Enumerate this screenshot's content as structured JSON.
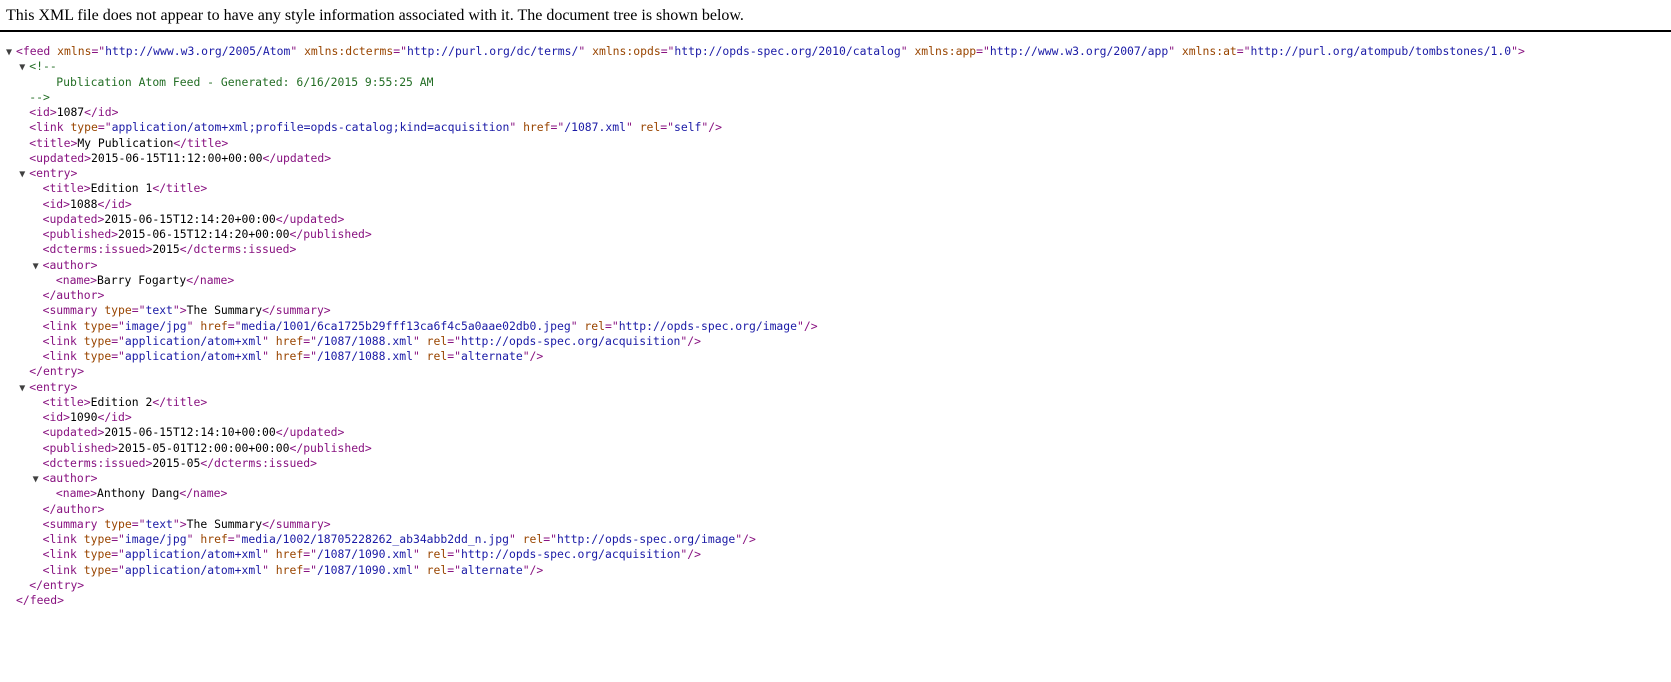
{
  "header": {
    "message": "This XML file does not appear to have any style information associated with it. The document tree is shown below."
  },
  "tree": [
    {
      "indent": 0,
      "toggle": true,
      "segs": [
        [
          "tag",
          "<feed"
        ],
        [
          "tx",
          " "
        ],
        [
          "an",
          "xmlns"
        ],
        [
          "tag",
          "=\""
        ],
        [
          "av",
          "http://www.w3.org/2005/Atom"
        ],
        [
          "tag",
          "\""
        ],
        [
          "tx",
          " "
        ],
        [
          "an",
          "xmlns:dcterms"
        ],
        [
          "tag",
          "=\""
        ],
        [
          "av",
          "http://purl.org/dc/terms/"
        ],
        [
          "tag",
          "\""
        ],
        [
          "tx",
          " "
        ],
        [
          "an",
          "xmlns:opds"
        ],
        [
          "tag",
          "=\""
        ],
        [
          "av",
          "http://opds-spec.org/2010/catalog"
        ],
        [
          "tag",
          "\""
        ],
        [
          "tx",
          " "
        ],
        [
          "an",
          "xmlns:app"
        ],
        [
          "tag",
          "=\""
        ],
        [
          "av",
          "http://www.w3.org/2007/app"
        ],
        [
          "tag",
          "\""
        ],
        [
          "tx",
          " "
        ],
        [
          "an",
          "xmlns:at"
        ],
        [
          "tag",
          "=\""
        ],
        [
          "av",
          "http://purl.org/atompub/tombstones/1.0"
        ],
        [
          "tag",
          "\">"
        ]
      ]
    },
    {
      "indent": 1,
      "toggle": true,
      "segs": [
        [
          "cm",
          "<!--"
        ]
      ]
    },
    {
      "indent": 2,
      "toggle": false,
      "segs": [
        [
          "cm",
          "  Publication Atom Feed - Generated: 6/16/2015 9:55:25 AM"
        ]
      ]
    },
    {
      "indent": 1,
      "toggle": false,
      "segs": [
        [
          "cm",
          "-->"
        ]
      ]
    },
    {
      "indent": 1,
      "toggle": false,
      "segs": [
        [
          "tag",
          "<id>"
        ],
        [
          "tx",
          "1087"
        ],
        [
          "tag",
          "</id>"
        ]
      ]
    },
    {
      "indent": 1,
      "toggle": false,
      "segs": [
        [
          "tag",
          "<link"
        ],
        [
          "tx",
          " "
        ],
        [
          "an",
          "type"
        ],
        [
          "tag",
          "=\""
        ],
        [
          "av",
          "application/atom+xml;profile=opds-catalog;kind=acquisition"
        ],
        [
          "tag",
          "\""
        ],
        [
          "tx",
          " "
        ],
        [
          "an",
          "href"
        ],
        [
          "tag",
          "=\""
        ],
        [
          "av",
          "/1087.xml"
        ],
        [
          "tag",
          "\""
        ],
        [
          "tx",
          " "
        ],
        [
          "an",
          "rel"
        ],
        [
          "tag",
          "=\""
        ],
        [
          "av",
          "self"
        ],
        [
          "tag",
          "\"/>"
        ]
      ]
    },
    {
      "indent": 1,
      "toggle": false,
      "segs": [
        [
          "tag",
          "<title>"
        ],
        [
          "tx",
          "My Publication"
        ],
        [
          "tag",
          "</title>"
        ]
      ]
    },
    {
      "indent": 1,
      "toggle": false,
      "segs": [
        [
          "tag",
          "<updated>"
        ],
        [
          "tx",
          "2015-06-15T11:12:00+00:00"
        ],
        [
          "tag",
          "</updated>"
        ]
      ]
    },
    {
      "indent": 1,
      "toggle": true,
      "segs": [
        [
          "tag",
          "<entry>"
        ]
      ]
    },
    {
      "indent": 2,
      "toggle": false,
      "segs": [
        [
          "tag",
          "<title>"
        ],
        [
          "tx",
          "Edition 1"
        ],
        [
          "tag",
          "</title>"
        ]
      ]
    },
    {
      "indent": 2,
      "toggle": false,
      "segs": [
        [
          "tag",
          "<id>"
        ],
        [
          "tx",
          "1088"
        ],
        [
          "tag",
          "</id>"
        ]
      ]
    },
    {
      "indent": 2,
      "toggle": false,
      "segs": [
        [
          "tag",
          "<updated>"
        ],
        [
          "tx",
          "2015-06-15T12:14:20+00:00"
        ],
        [
          "tag",
          "</updated>"
        ]
      ]
    },
    {
      "indent": 2,
      "toggle": false,
      "segs": [
        [
          "tag",
          "<published>"
        ],
        [
          "tx",
          "2015-06-15T12:14:20+00:00"
        ],
        [
          "tag",
          "</published>"
        ]
      ]
    },
    {
      "indent": 2,
      "toggle": false,
      "segs": [
        [
          "tag",
          "<dcterms:issued>"
        ],
        [
          "tx",
          "2015"
        ],
        [
          "tag",
          "</dcterms:issued>"
        ]
      ]
    },
    {
      "indent": 2,
      "toggle": true,
      "segs": [
        [
          "tag",
          "<author>"
        ]
      ]
    },
    {
      "indent": 3,
      "toggle": false,
      "segs": [
        [
          "tag",
          "<name>"
        ],
        [
          "tx",
          "Barry Fogarty"
        ],
        [
          "tag",
          "</name>"
        ]
      ]
    },
    {
      "indent": 2,
      "toggle": false,
      "segs": [
        [
          "tag",
          "</author>"
        ]
      ]
    },
    {
      "indent": 2,
      "toggle": false,
      "segs": [
        [
          "tag",
          "<summary"
        ],
        [
          "tx",
          " "
        ],
        [
          "an",
          "type"
        ],
        [
          "tag",
          "=\""
        ],
        [
          "av",
          "text"
        ],
        [
          "tag",
          "\">"
        ],
        [
          "tx",
          "The Summary"
        ],
        [
          "tag",
          "</summary>"
        ]
      ]
    },
    {
      "indent": 2,
      "toggle": false,
      "segs": [
        [
          "tag",
          "<link"
        ],
        [
          "tx",
          " "
        ],
        [
          "an",
          "type"
        ],
        [
          "tag",
          "=\""
        ],
        [
          "av",
          "image/jpg"
        ],
        [
          "tag",
          "\""
        ],
        [
          "tx",
          " "
        ],
        [
          "an",
          "href"
        ],
        [
          "tag",
          "=\""
        ],
        [
          "av",
          "media/1001/6ca1725b29fff13ca6f4c5a0aae02db0.jpeg"
        ],
        [
          "tag",
          "\""
        ],
        [
          "tx",
          " "
        ],
        [
          "an",
          "rel"
        ],
        [
          "tag",
          "=\""
        ],
        [
          "av",
          "http://opds-spec.org/image"
        ],
        [
          "tag",
          "\"/>"
        ]
      ]
    },
    {
      "indent": 2,
      "toggle": false,
      "segs": [
        [
          "tag",
          "<link"
        ],
        [
          "tx",
          " "
        ],
        [
          "an",
          "type"
        ],
        [
          "tag",
          "=\""
        ],
        [
          "av",
          "application/atom+xml"
        ],
        [
          "tag",
          "\""
        ],
        [
          "tx",
          " "
        ],
        [
          "an",
          "href"
        ],
        [
          "tag",
          "=\""
        ],
        [
          "av",
          "/1087/1088.xml"
        ],
        [
          "tag",
          "\""
        ],
        [
          "tx",
          " "
        ],
        [
          "an",
          "rel"
        ],
        [
          "tag",
          "=\""
        ],
        [
          "av",
          "http://opds-spec.org/acquisition"
        ],
        [
          "tag",
          "\"/>"
        ]
      ]
    },
    {
      "indent": 2,
      "toggle": false,
      "segs": [
        [
          "tag",
          "<link"
        ],
        [
          "tx",
          " "
        ],
        [
          "an",
          "type"
        ],
        [
          "tag",
          "=\""
        ],
        [
          "av",
          "application/atom+xml"
        ],
        [
          "tag",
          "\""
        ],
        [
          "tx",
          " "
        ],
        [
          "an",
          "href"
        ],
        [
          "tag",
          "=\""
        ],
        [
          "av",
          "/1087/1088.xml"
        ],
        [
          "tag",
          "\""
        ],
        [
          "tx",
          " "
        ],
        [
          "an",
          "rel"
        ],
        [
          "tag",
          "=\""
        ],
        [
          "av",
          "alternate"
        ],
        [
          "tag",
          "\"/>"
        ]
      ]
    },
    {
      "indent": 1,
      "toggle": false,
      "segs": [
        [
          "tag",
          "</entry>"
        ]
      ]
    },
    {
      "indent": 1,
      "toggle": true,
      "segs": [
        [
          "tag",
          "<entry>"
        ]
      ]
    },
    {
      "indent": 2,
      "toggle": false,
      "segs": [
        [
          "tag",
          "<title>"
        ],
        [
          "tx",
          "Edition 2"
        ],
        [
          "tag",
          "</title>"
        ]
      ]
    },
    {
      "indent": 2,
      "toggle": false,
      "segs": [
        [
          "tag",
          "<id>"
        ],
        [
          "tx",
          "1090"
        ],
        [
          "tag",
          "</id>"
        ]
      ]
    },
    {
      "indent": 2,
      "toggle": false,
      "segs": [
        [
          "tag",
          "<updated>"
        ],
        [
          "tx",
          "2015-06-15T12:14:10+00:00"
        ],
        [
          "tag",
          "</updated>"
        ]
      ]
    },
    {
      "indent": 2,
      "toggle": false,
      "segs": [
        [
          "tag",
          "<published>"
        ],
        [
          "tx",
          "2015-05-01T12:00:00+00:00"
        ],
        [
          "tag",
          "</published>"
        ]
      ]
    },
    {
      "indent": 2,
      "toggle": false,
      "segs": [
        [
          "tag",
          "<dcterms:issued>"
        ],
        [
          "tx",
          "2015-05"
        ],
        [
          "tag",
          "</dcterms:issued>"
        ]
      ]
    },
    {
      "indent": 2,
      "toggle": true,
      "segs": [
        [
          "tag",
          "<author>"
        ]
      ]
    },
    {
      "indent": 3,
      "toggle": false,
      "segs": [
        [
          "tag",
          "<name>"
        ],
        [
          "tx",
          "Anthony Dang"
        ],
        [
          "tag",
          "</name>"
        ]
      ]
    },
    {
      "indent": 2,
      "toggle": false,
      "segs": [
        [
          "tag",
          "</author>"
        ]
      ]
    },
    {
      "indent": 2,
      "toggle": false,
      "segs": [
        [
          "tag",
          "<summary"
        ],
        [
          "tx",
          " "
        ],
        [
          "an",
          "type"
        ],
        [
          "tag",
          "=\""
        ],
        [
          "av",
          "text"
        ],
        [
          "tag",
          "\">"
        ],
        [
          "tx",
          "The Summary"
        ],
        [
          "tag",
          "</summary>"
        ]
      ]
    },
    {
      "indent": 2,
      "toggle": false,
      "segs": [
        [
          "tag",
          "<link"
        ],
        [
          "tx",
          " "
        ],
        [
          "an",
          "type"
        ],
        [
          "tag",
          "=\""
        ],
        [
          "av",
          "image/jpg"
        ],
        [
          "tag",
          "\""
        ],
        [
          "tx",
          " "
        ],
        [
          "an",
          "href"
        ],
        [
          "tag",
          "=\""
        ],
        [
          "av",
          "media/1002/18705228262_ab34abb2dd_n.jpg"
        ],
        [
          "tag",
          "\""
        ],
        [
          "tx",
          " "
        ],
        [
          "an",
          "rel"
        ],
        [
          "tag",
          "=\""
        ],
        [
          "av",
          "http://opds-spec.org/image"
        ],
        [
          "tag",
          "\"/>"
        ]
      ]
    },
    {
      "indent": 2,
      "toggle": false,
      "segs": [
        [
          "tag",
          "<link"
        ],
        [
          "tx",
          " "
        ],
        [
          "an",
          "type"
        ],
        [
          "tag",
          "=\""
        ],
        [
          "av",
          "application/atom+xml"
        ],
        [
          "tag",
          "\""
        ],
        [
          "tx",
          " "
        ],
        [
          "an",
          "href"
        ],
        [
          "tag",
          "=\""
        ],
        [
          "av",
          "/1087/1090.xml"
        ],
        [
          "tag",
          "\""
        ],
        [
          "tx",
          " "
        ],
        [
          "an",
          "rel"
        ],
        [
          "tag",
          "=\""
        ],
        [
          "av",
          "http://opds-spec.org/acquisition"
        ],
        [
          "tag",
          "\"/>"
        ]
      ]
    },
    {
      "indent": 2,
      "toggle": false,
      "segs": [
        [
          "tag",
          "<link"
        ],
        [
          "tx",
          " "
        ],
        [
          "an",
          "type"
        ],
        [
          "tag",
          "=\""
        ],
        [
          "av",
          "application/atom+xml"
        ],
        [
          "tag",
          "\""
        ],
        [
          "tx",
          " "
        ],
        [
          "an",
          "href"
        ],
        [
          "tag",
          "=\""
        ],
        [
          "av",
          "/1087/1090.xml"
        ],
        [
          "tag",
          "\""
        ],
        [
          "tx",
          " "
        ],
        [
          "an",
          "rel"
        ],
        [
          "tag",
          "=\""
        ],
        [
          "av",
          "alternate"
        ],
        [
          "tag",
          "\"/>"
        ]
      ]
    },
    {
      "indent": 1,
      "toggle": false,
      "segs": [
        [
          "tag",
          "</entry>"
        ]
      ]
    },
    {
      "indent": 0,
      "toggle": false,
      "segs": [
        [
          "tag",
          "</feed>"
        ]
      ]
    }
  ],
  "icons": {
    "toggle": "expanded-triangle-icon"
  },
  "colors": {
    "tag": "#881280",
    "attribute_name": "#994500",
    "attribute_value": "#1a1aa6",
    "comment": "#236e25"
  }
}
